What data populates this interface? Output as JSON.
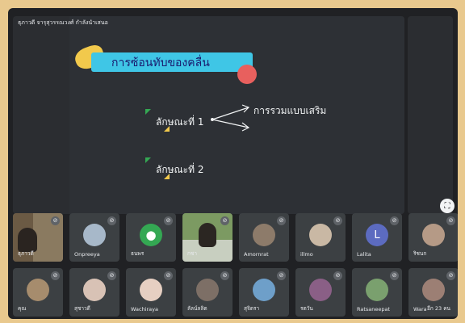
{
  "presenter": {
    "label": "ธุภาวดี จารุสุวรรณวงศ์ กำลังนำเสนอ"
  },
  "slide": {
    "title": "การซ้อนทับของคลื่น",
    "bullet1": "ลักษณะที่ 1",
    "bullet2": "ลักษณะที่ 2",
    "arrow_label": "การรวมแบบเสริม"
  },
  "participants": {
    "row1": [
      {
        "name": "ธุภาวดี",
        "icon": "video-person"
      },
      {
        "name": "Onpreeya",
        "icon": "avatar-photo"
      },
      {
        "name": "ธนพร",
        "icon": "person-silhouette-icon"
      },
      {
        "name": "กชา",
        "icon": "video-person"
      },
      {
        "name": "Amornrat",
        "icon": "avatar-photo"
      },
      {
        "name": "illmo",
        "icon": "avatar-photo"
      },
      {
        "name": "Lalita",
        "icon": "letter-avatar",
        "letter": "L"
      },
      {
        "name": "ริชนก",
        "icon": "avatar-photo"
      }
    ],
    "row2": [
      {
        "name": "คุณ",
        "icon": "avatar-photo"
      },
      {
        "name": "สุชาวดี",
        "icon": "avatar-photo"
      },
      {
        "name": "Wachiraya",
        "icon": "avatar-photo"
      },
      {
        "name": "ลัลน์ลลิต",
        "icon": "avatar-photo"
      },
      {
        "name": "สุจิตรา",
        "icon": "avatar-photo"
      },
      {
        "name": "รตวัน",
        "icon": "avatar-photo"
      },
      {
        "name": "Ratsaneepat",
        "icon": "avatar-photo"
      },
      {
        "name": "Wara",
        "icon": "avatar-photo"
      }
    ],
    "more_label": "อีก 23 คน"
  },
  "colors": {
    "background": "#e9c98e",
    "stage": "#202124",
    "tile": "#3c4043",
    "title_bar": "#3fc6e6",
    "accent_green": "#34a853",
    "letter_avatar": "#5c6bc0"
  }
}
